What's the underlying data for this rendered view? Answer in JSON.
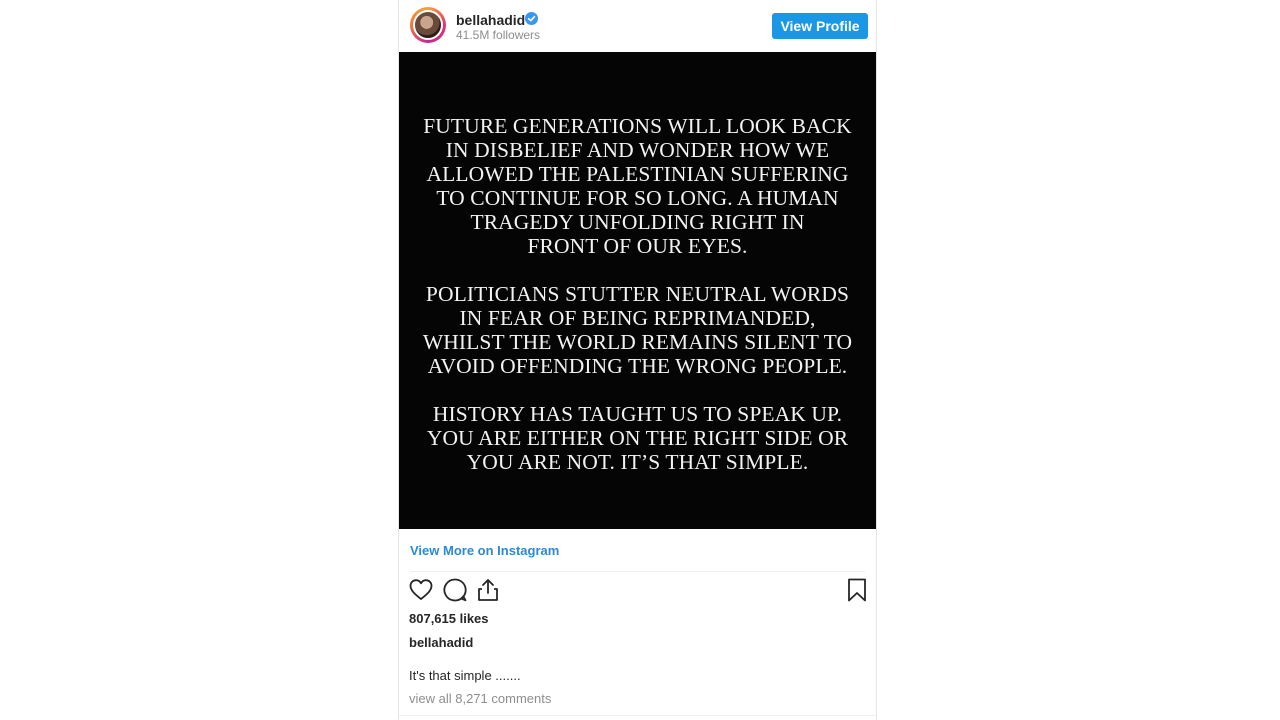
{
  "header": {
    "username": "bellahadid",
    "followers": "41.5M followers",
    "view_profile_label": "View Profile"
  },
  "post": {
    "paragraphs": [
      "FUTURE GENERATIONS WILL LOOK BACK\nIN DISBELIEF AND WONDER HOW WE\nALLOWED THE PALESTINIAN SUFFERING\nTO CONTINUE FOR SO LONG. A HUMAN\nTRAGEDY UNFOLDING RIGHT IN\nFRONT OF OUR EYES.",
      "POLITICIANS STUTTER NEUTRAL WORDS\nIN FEAR OF BEING REPRIMANDED,\nWHILST THE WORLD REMAINS SILENT  TO\nAVOID OFFENDING THE WRONG PEOPLE.",
      "HISTORY HAS TAUGHT US TO SPEAK UP.\nYOU ARE EITHER ON THE RIGHT SIDE OR\nYOU ARE NOT.  IT’S THAT SIMPLE."
    ],
    "background_color": "#050505",
    "text_color": "#f2f2f2"
  },
  "footer": {
    "view_more_label": "View More on Instagram",
    "likes": "807,615 likes",
    "caption_username": "bellahadid",
    "caption": "It's that simple .......",
    "comments_link": "view all 8,271 comments"
  },
  "icons": [
    "heart-icon",
    "comment-icon",
    "share-icon",
    "bookmark-icon",
    "verified-badge-icon"
  ],
  "colors": {
    "accent": "#1a98e6",
    "link": "#2b8ad7",
    "muted": "#8e8e8e",
    "text": "#262626"
  }
}
